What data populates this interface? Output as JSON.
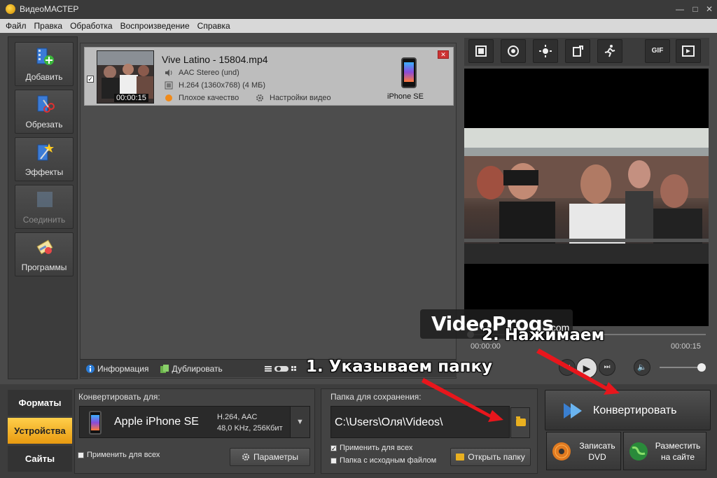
{
  "window": {
    "title": "ВидеоМАСТЕР"
  },
  "menu": [
    "Файл",
    "Правка",
    "Обработка",
    "Воспроизведение",
    "Справка"
  ],
  "tools": [
    {
      "label": "Добавить",
      "icon": "add-film-icon",
      "enabled": true
    },
    {
      "label": "Обрезать",
      "icon": "scissors-film-icon",
      "enabled": true
    },
    {
      "label": "Эффекты",
      "icon": "magic-wand-icon",
      "enabled": true
    },
    {
      "label": "Соединить",
      "icon": "join-film-icon",
      "enabled": false
    },
    {
      "label": "Программы",
      "icon": "programs-icon",
      "enabled": true
    }
  ],
  "file": {
    "name": "Vive Latino - 15804.mp4",
    "audio": "AAC Stereo (und)",
    "video": "H.264 (1360x768) (4 МБ)",
    "quality": "Плохое качество",
    "settings": "Настройки видео",
    "duration": "00:00:15",
    "device": "iPhone SE",
    "checked": true
  },
  "listbar": {
    "info": "Информация",
    "duplicate": "Дублировать"
  },
  "preview_tools": [
    "crop-icon",
    "stabilize-icon",
    "brightness-icon",
    "rotate-icon",
    "speed-icon",
    "GIF",
    "fullscreen-icon"
  ],
  "player": {
    "time_current": "00:00:00",
    "time_total": "00:00:15",
    "progress": 0,
    "volume": 0.95
  },
  "tabs": [
    {
      "label": "Форматы",
      "active": false
    },
    {
      "label": "Устройства",
      "active": true
    },
    {
      "label": "Сайты",
      "active": false
    }
  ],
  "convert_for": {
    "label": "Конвертировать для:",
    "device": "Apple iPhone SE",
    "spec_line1": "H.264, AAC",
    "spec_line2": "48,0 KHz, 256Кбит",
    "apply_all": "Применить для всех",
    "params": "Параметры"
  },
  "save": {
    "label": "Папка для сохранения:",
    "path": "C:\\Users\\Оля\\Videos\\",
    "apply_all": "Применить для всех",
    "apply_all_checked": true,
    "source_folder": "Папка с исходным файлом",
    "source_folder_checked": false,
    "open_folder": "Открыть папку"
  },
  "actions": {
    "convert": "Конвертировать",
    "dvd_line1": "Записать",
    "dvd_line2": "DVD",
    "site_line1": "Разместить",
    "site_line2": "на сайте"
  },
  "annotations": {
    "step1": "1. Указываем папку",
    "step2": "2. Нажимаем",
    "watermark": "VideoProgs",
    "watermark_com": ".com",
    "arrow_color": "#e8161c"
  }
}
